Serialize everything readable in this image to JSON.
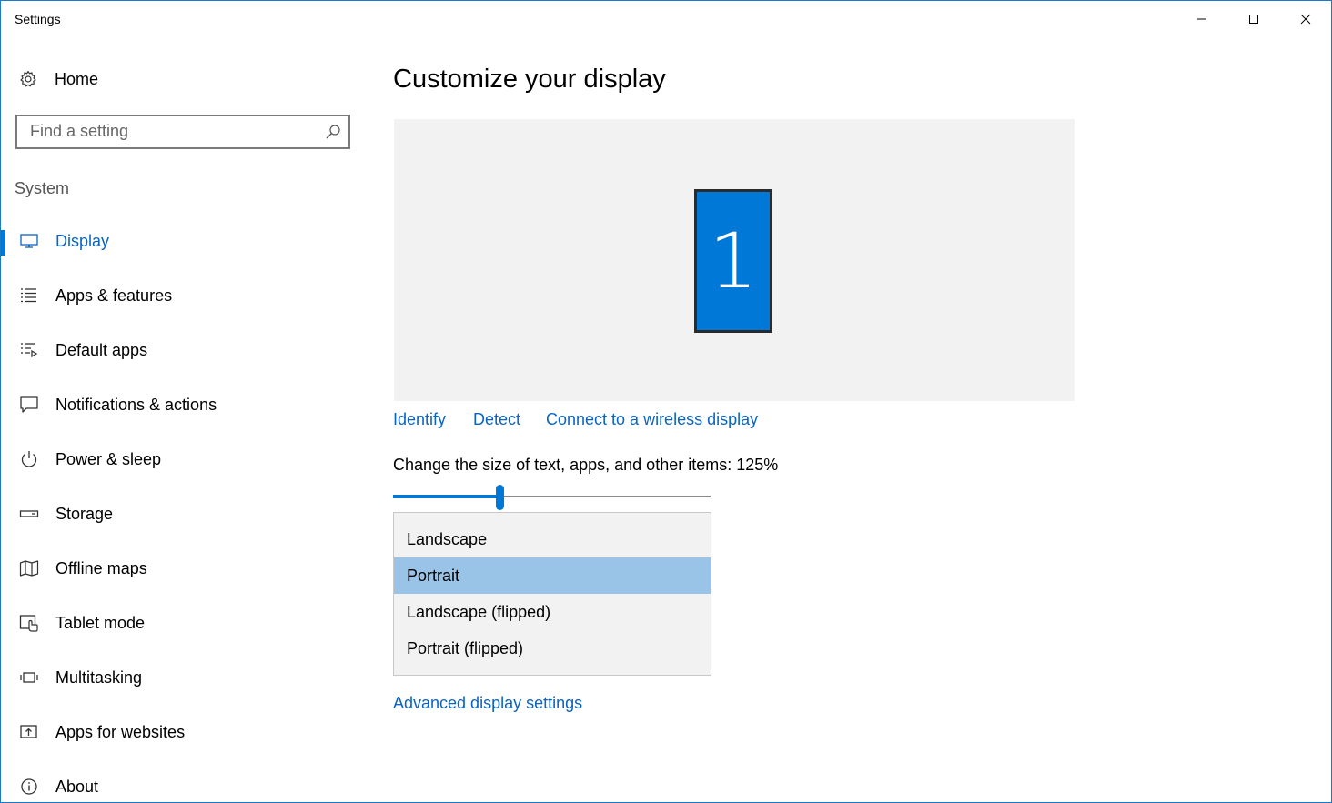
{
  "window": {
    "title": "Settings",
    "accent": "#0078d7",
    "link_color": "#0a64c2"
  },
  "sidebar": {
    "home_label": "Home",
    "home_icon": "gear-icon",
    "search_placeholder": "Find a setting",
    "search_icon": "search-icon",
    "section_title": "System",
    "items": [
      {
        "label": "Display",
        "icon": "monitor-icon",
        "active": true
      },
      {
        "label": "Apps & features",
        "icon": "apps-list-icon",
        "active": false
      },
      {
        "label": "Default apps",
        "icon": "default-apps-icon",
        "active": false
      },
      {
        "label": "Notifications & actions",
        "icon": "notification-icon",
        "active": false
      },
      {
        "label": "Power & sleep",
        "icon": "power-icon",
        "active": false
      },
      {
        "label": "Storage",
        "icon": "storage-icon",
        "active": false
      },
      {
        "label": "Offline maps",
        "icon": "map-icon",
        "active": false
      },
      {
        "label": "Tablet mode",
        "icon": "tablet-mode-icon",
        "active": false
      },
      {
        "label": "Multitasking",
        "icon": "multitasking-icon",
        "active": false
      },
      {
        "label": "Apps for websites",
        "icon": "apps-for-websites-icon",
        "active": false
      },
      {
        "label": "About",
        "icon": "info-icon",
        "active": false
      }
    ]
  },
  "main": {
    "title": "Customize your display",
    "monitor_number": "1",
    "links": {
      "identify": "Identify",
      "detect": "Detect",
      "wireless": "Connect to a wireless display"
    },
    "scale_label": "Change the size of text, apps, and other items: 125%",
    "scale_slider_fraction": 0.335,
    "orientation": {
      "selected": "Portrait",
      "options": [
        "Landscape",
        "Portrait",
        "Landscape (flipped)",
        "Portrait (flipped)"
      ]
    },
    "advanced_link": "Advanced display settings"
  }
}
